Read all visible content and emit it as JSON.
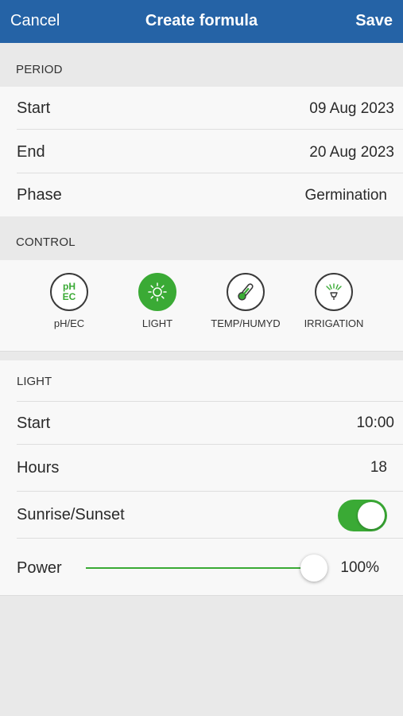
{
  "nav": {
    "cancel": "Cancel",
    "title": "Create formula",
    "save": "Save"
  },
  "period": {
    "header": "PERIOD",
    "start_label": "Start",
    "start_value": "09 Aug 2023",
    "end_label": "End",
    "end_value": "20 Aug 2023",
    "phase_label": "Phase",
    "phase_value": "Germination"
  },
  "control": {
    "header": "CONTROL",
    "items": [
      {
        "label": "pH/EC",
        "icon": "ph-ec-icon",
        "icon_text_1": "pH",
        "icon_text_2": "EC",
        "active": false
      },
      {
        "label": "LIGHT",
        "icon": "sun-icon",
        "active": true
      },
      {
        "label": "TEMP/HUMYD",
        "icon": "thermometer-icon",
        "active": false
      },
      {
        "label": "IRRIGATION",
        "icon": "sprinkler-icon",
        "active": false
      }
    ]
  },
  "light": {
    "header": "LIGHT",
    "start_label": "Start",
    "start_value": "10:00",
    "hours_label": "Hours",
    "hours_value": "18",
    "sunrise_label": "Sunrise/Sunset",
    "sunrise_on": true,
    "power_label": "Power",
    "power_value": "100%",
    "power_level": 1.0
  },
  "colors": {
    "nav": "#2563a6",
    "accent": "#3aaa35",
    "background": "#e9e9e9"
  }
}
